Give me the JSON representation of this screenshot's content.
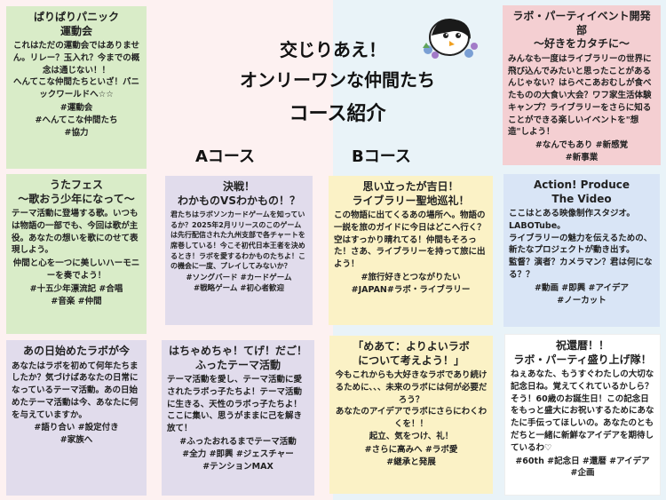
{
  "header": {
    "title_line1": "交じりあえ！",
    "title_line2": "オンリーワンな仲間たち",
    "subtitle": "コース紹介",
    "course_a": "Aコース",
    "course_b": "Bコース"
  },
  "cards": {
    "c1": {
      "title": "ぱりぱりパニック\n運動会",
      "body": "これはただの運動会ではありません。リレー？玉入れ？今までの概念は通じない！！\nへんてこな仲間たちといざ！パニックワールドへ☆☆",
      "tags": "#運動会\n#へんてこな仲間たち\n#協力"
    },
    "c2": {
      "title": "うたフェス\n～歌おう少年になって～",
      "body": "テーマ活動に登場する歌。いつもは物語の一部でも、今回は歌が主役。あなたの想いを歌にのせて表現しよう。",
      "body2": "仲間と心を一つに美しいハーモニーを奏でよう！",
      "tags": "#十五少年漂流記 #合唱\n#音楽 #仲間"
    },
    "c3": {
      "title": "あの日始めたラボが今",
      "body": "あなたはラボを初めて何年たちましたか？気づけばあなたの日常になっているテーマ活動。あの日始めたテーマ活動は今、あなたに何を与えていますか。",
      "tags": "#語り合い #設定付き\n#家族へ"
    },
    "c4": {
      "title": "決戦！\nわかものVSわかもの！？",
      "body": "君たちはラボソンカードゲームを知っているか？2025年2月リリースのこのゲームは先行配信された九州支部で各チャートを席巻している！今こそ初代日本王者を決めるとき！ラボを愛するわかものたちよ！この機会に一度、プレイしてみないか？",
      "tags": "#ソングバード #カードゲーム\n#戦略ゲーム #初心者歓迎"
    },
    "c5": {
      "title": "はちゃめちゃ！てげ！だご！\nふったテーマ活動",
      "body": "テーマ活動を愛し、テーマ活動に愛されたラボっ子たちよ！テーマ活動に生きる、天性のラボっ子たちよ！ここに集い、思うがままに己を解き放て！",
      "tags": "#ふったおれるまでテーマ活動\n#全力 #即興 #ジェスチャー\n#テンションMAX"
    },
    "c6": {
      "title": "思い立ったが吉日！\nライブラリー聖地巡礼！",
      "body": "この物語に出てくるあの場所へ。物語の一説を旅のガイドに今日はどこへ行く？空はすっかり晴れてる！仲間もそろった！さあ、ライブラリーを持って旅に出よう！",
      "tags": "#旅行好きとつながりたい\n#JAPAN#ラボ・ライブラリー"
    },
    "c7": {
      "title": "「めあて：よりよいラボ\nについて考えよう！」",
      "body": "今もこれからも大好きなラボであり続けるために、、、未来のラボには何が必要だろう？\nあなたのアイデアでラボにさらにわくわくを！！\n起立、気をつけ、礼！",
      "tags": "#さらに高みへ #ラボ愛\n#継承と発展"
    },
    "c8": {
      "title": "ラボ・パーティイベント開発部\n～好きをカタチに～",
      "body": "みんなも一度はライブラリーの世界に飛び込んでみたいと思ったことがあるんじゃない？はらぺこあおむしが食べたものの大食い大会？ワフ家生活体験キャンプ？ライブラリーをさらに知ることができる楽しいイベントを\"想造\"しよう！",
      "tags": "#なんでもあり #新感覚\n#新事業"
    },
    "c9": {
      "title": "Action! Produce\nThe Video",
      "body": "ここはとある映像制作スタジオ。LABOTube。\nライブラリーの魅力を伝えるための、新たなプロジェクトが動き出す。\n監督？演者？カメラマン？君は何になる？？",
      "tags": "#動画 #即興 #アイデア\n#ノーカット"
    },
    "c10": {
      "title": "祝還暦！！\nラボ・パーティ盛り上げ隊！",
      "body": "ねぇあなた、もうすぐわたしの大切な記念日ね。覚えてくれているかしら？そう！60歳のお誕生日！この記念日をもっと盛大にお祝いするためにあなたに手伝ってほしいの。あなたのともだちと一緒に新鮮なアイデアを期待しているわ♡",
      "tags": "#60th #記念日 #還暦 #アイデア\n#企画"
    }
  },
  "colors": {
    "left_bg": "#fdf1f1",
    "right_bg": "#e9f3f8",
    "green": "#d9ecc8",
    "yellow": "#fbf2c6",
    "purple": "#e1dcec",
    "blue": "#d9e5f6",
    "pink": "#f4cfd2"
  },
  "mascot_icon": "penguin-mascot-icon"
}
